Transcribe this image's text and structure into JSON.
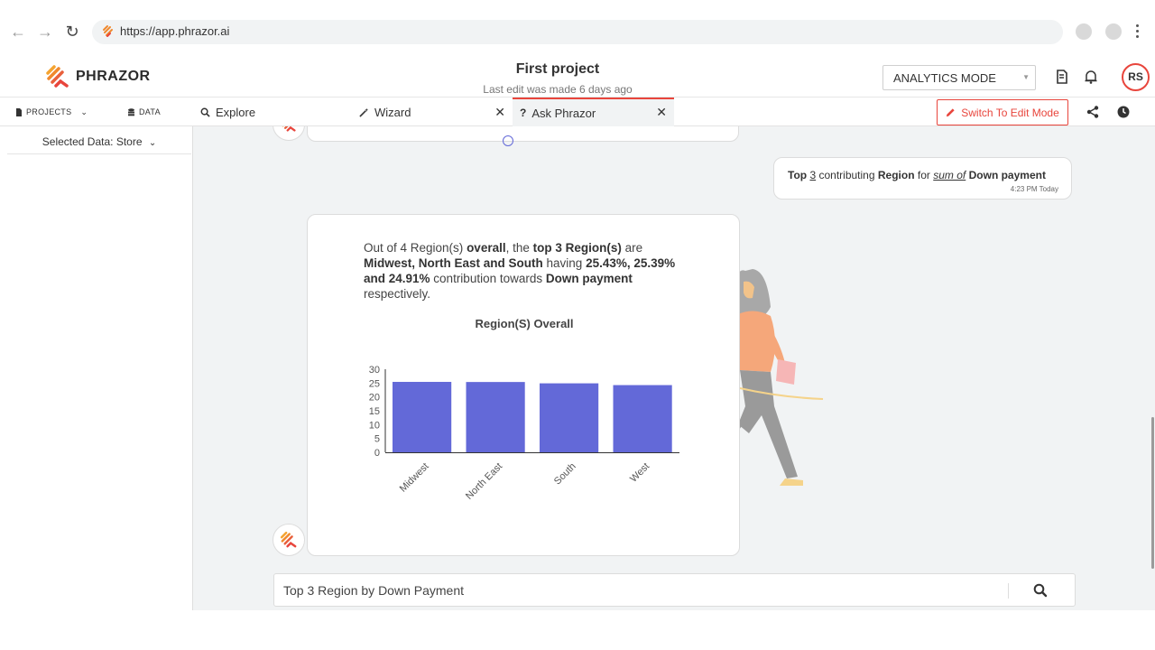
{
  "browser": {
    "url": "https://app.phrazor.ai",
    "back_icon": "arrow-left-icon",
    "forward_icon": "arrow-right-icon",
    "reload_icon": "reload-icon"
  },
  "header": {
    "brand": "PHRAZOR",
    "project_title": "First project",
    "last_edit": "Last edit was made 6 days ago",
    "mode": "ANALYTICS MODE",
    "avatar_initials": "RS"
  },
  "tabs_bar": {
    "projects_label": "PROJECTS",
    "data_label": "DATA",
    "tabs": [
      {
        "label": "Explore",
        "icon": "search-icon"
      },
      {
        "label": "Wizard",
        "icon": "wand-icon"
      },
      {
        "label": "Ask Phrazor",
        "icon": "question-icon"
      }
    ],
    "edit_button": "Switch To Edit Mode"
  },
  "sidebar": {
    "selected_data": "Selected Data: Store"
  },
  "chat": {
    "user_query": {
      "part1": "Top",
      "part2": "3",
      "part3": "contributing",
      "part4": "Region",
      "part5": "for",
      "part6": "sum of",
      "part7": "Down payment",
      "time": "4:23 PM Today"
    },
    "answer": {
      "t1": "Out of 4 Region(s) ",
      "t2": "overall",
      "t3": ", the ",
      "t4": "top 3 Region(s)",
      "t5": " are ",
      "t6": "Midwest, North East and South",
      "t7": " having ",
      "t8": "25.43%, 25.39% and 24.91%",
      "t9": " contribution towards ",
      "t10": "Down payment",
      "t11": " respectively."
    }
  },
  "chart_data": {
    "type": "bar",
    "title": "Region(S) Overall",
    "categories": [
      "Midwest",
      "North East",
      "South",
      "West"
    ],
    "values": [
      25.43,
      25.39,
      24.91,
      24.27
    ],
    "yticks": [
      "0",
      "5",
      "10",
      "15",
      "20",
      "25",
      "30"
    ],
    "ylim": [
      0,
      30
    ],
    "bar_color": "#6369d8",
    "grid": false
  },
  "search": {
    "value": "Top 3 Region by Down Payment"
  },
  "colors": {
    "accent": "#e8453c",
    "bar": "#6369d8"
  }
}
